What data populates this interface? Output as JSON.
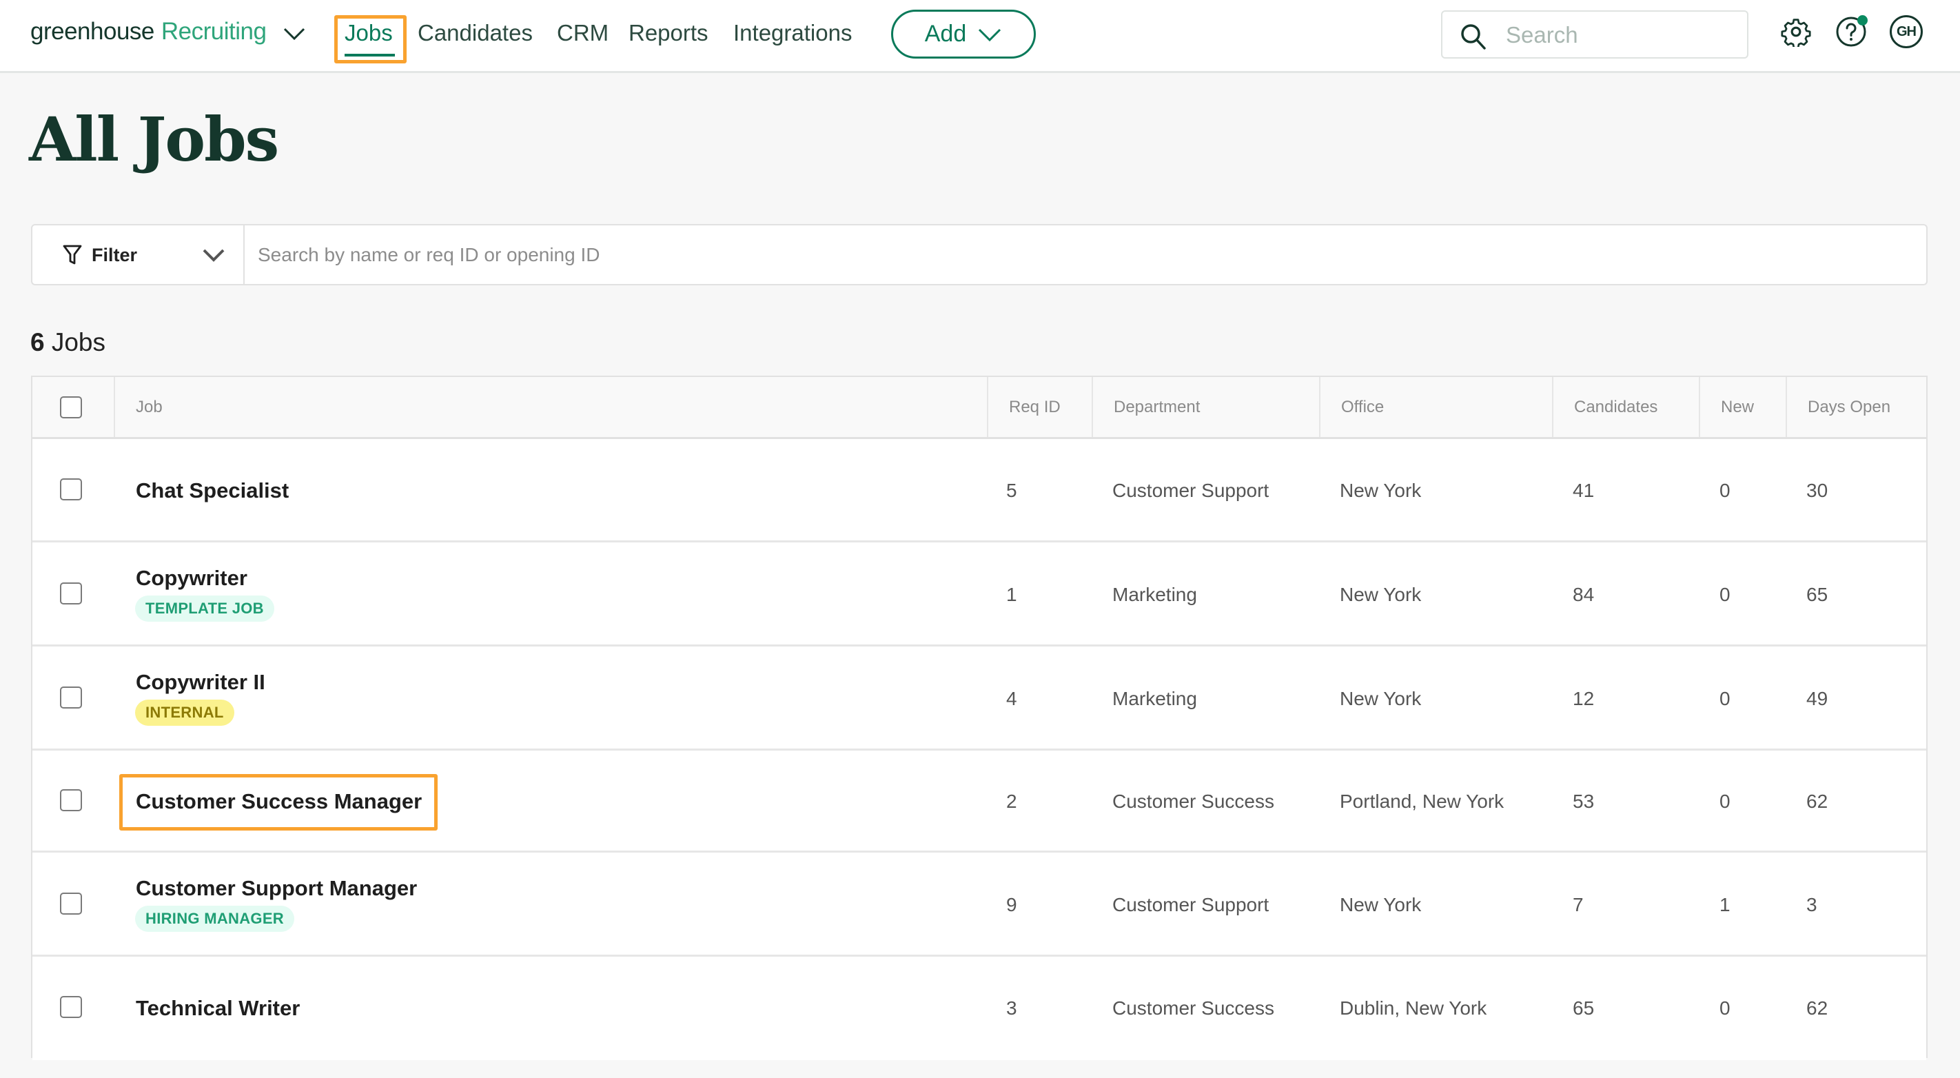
{
  "app": {
    "brand_primary": "greenhouse",
    "brand_secondary": "Recruiting"
  },
  "nav": {
    "items": [
      {
        "label": "Jobs",
        "active": true
      },
      {
        "label": "Candidates",
        "active": false
      },
      {
        "label": "CRM",
        "active": false
      },
      {
        "label": "Reports",
        "active": false
      },
      {
        "label": "Integrations",
        "active": false
      }
    ],
    "add_button": "Add",
    "search_placeholder": "Search",
    "avatar_initials": "GH",
    "icons": {
      "settings": "gear-icon",
      "help": "question-circle-icon",
      "search": "magnifier-icon"
    }
  },
  "page": {
    "title": "All Jobs",
    "filter_label": "Filter",
    "filter_search_placeholder": "Search by name or req ID or opening ID",
    "job_count_number": "6",
    "job_count_label": "Jobs"
  },
  "table": {
    "columns": [
      "Job",
      "Req ID",
      "Department",
      "Office",
      "Candidates",
      "New",
      "Days Open"
    ],
    "rows": [
      {
        "job": "Chat Specialist",
        "tag": "",
        "tag_color": "",
        "req_id": "5",
        "department": "Customer Support",
        "office": "New York",
        "candidates": "41",
        "new": "0",
        "days_open": "30"
      },
      {
        "job": "Copywriter",
        "tag": "TEMPLATE JOB",
        "tag_color": "green",
        "req_id": "1",
        "department": "Marketing",
        "office": "New York",
        "candidates": "84",
        "new": "0",
        "days_open": "65"
      },
      {
        "job": "Copywriter II",
        "tag": "INTERNAL",
        "tag_color": "yellow",
        "req_id": "4",
        "department": "Marketing",
        "office": "New York",
        "candidates": "12",
        "new": "0",
        "days_open": "49"
      },
      {
        "job": "Customer Success Manager",
        "tag": "",
        "tag_color": "",
        "req_id": "2",
        "department": "Customer Success",
        "office": "Portland, New York",
        "candidates": "53",
        "new": "0",
        "days_open": "62"
      },
      {
        "job": "Customer Support Manager",
        "tag": "HIRING MANAGER",
        "tag_color": "green",
        "req_id": "9",
        "department": "Customer Support",
        "office": "New York",
        "candidates": "7",
        "new": "1",
        "days_open": "3"
      },
      {
        "job": "Technical Writer",
        "tag": "",
        "tag_color": "",
        "req_id": "3",
        "department": "Customer Success",
        "office": "Dublin, New York",
        "candidates": "65",
        "new": "0",
        "days_open": "62"
      }
    ]
  },
  "colors": {
    "brand_dark": "#15372c",
    "brand_green": "#0a7a5a",
    "highlight": "#f9a22f",
    "notification_dot": "#0a8a60"
  }
}
